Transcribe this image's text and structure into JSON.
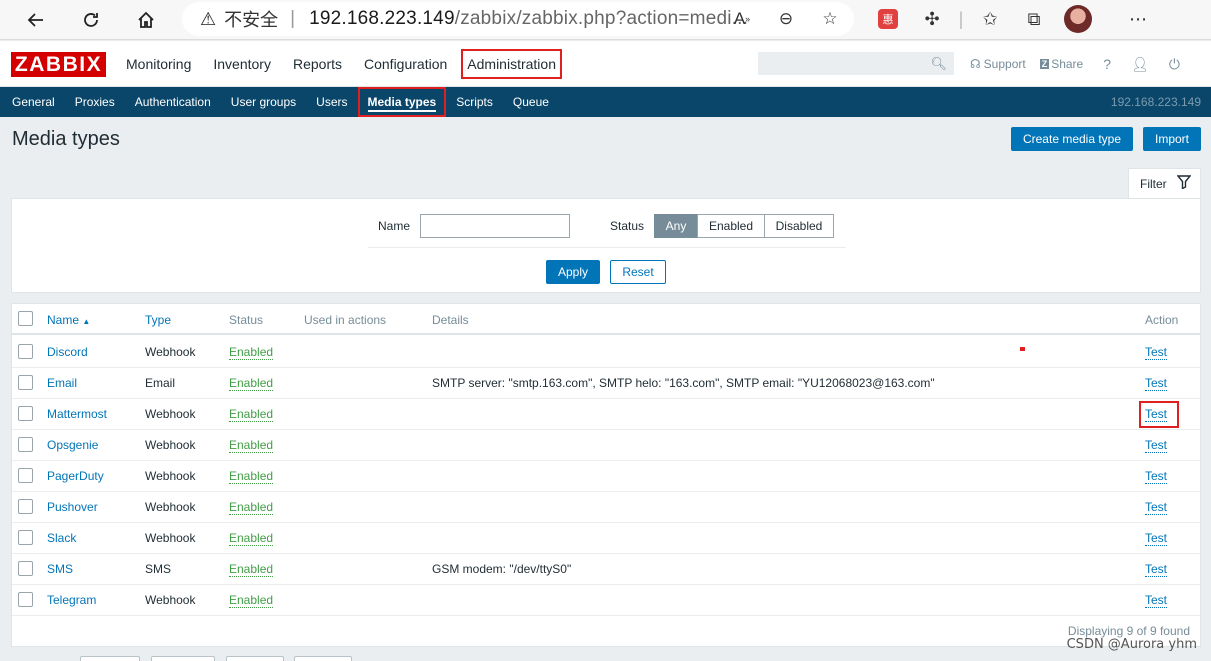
{
  "browser": {
    "insecure_label": "不安全",
    "url_host": "192.168.223.149",
    "url_rest": "/zabbix/zabbix.php?action=medi..."
  },
  "header": {
    "logo": "ZABBIX",
    "menu": [
      "Monitoring",
      "Inventory",
      "Reports",
      "Configuration",
      "Administration"
    ],
    "selected_menu": "Administration",
    "support": "Support",
    "share": "Share",
    "help": "?"
  },
  "subnav": {
    "items": [
      "General",
      "Proxies",
      "Authentication",
      "User groups",
      "Users",
      "Media types",
      "Scripts",
      "Queue"
    ],
    "selected": "Media types",
    "server": "192.168.223.149"
  },
  "page": {
    "title": "Media types",
    "create_button": "Create media type",
    "import_button": "Import"
  },
  "filter": {
    "tab_label": "Filter",
    "name_label": "Name",
    "name_value": "",
    "status_label": "Status",
    "status_options": [
      "Any",
      "Enabled",
      "Disabled"
    ],
    "status_selected": "Any",
    "apply": "Apply",
    "reset": "Reset"
  },
  "table": {
    "headers": {
      "name": "Name",
      "sort_indicator": "▲",
      "type": "Type",
      "status": "Status",
      "used": "Used in actions",
      "details": "Details",
      "action": "Action"
    },
    "rows": [
      {
        "name": "Discord",
        "type": "Webhook",
        "status": "Enabled",
        "details": "",
        "action": "Test"
      },
      {
        "name": "Email",
        "type": "Email",
        "status": "Enabled",
        "details": "SMTP server: \"smtp.163.com\", SMTP helo: \"163.com\", SMTP email: \"YU12068023@163.com\"",
        "action": "Test"
      },
      {
        "name": "Mattermost",
        "type": "Webhook",
        "status": "Enabled",
        "details": "",
        "action": "Test"
      },
      {
        "name": "Opsgenie",
        "type": "Webhook",
        "status": "Enabled",
        "details": "",
        "action": "Test"
      },
      {
        "name": "PagerDuty",
        "type": "Webhook",
        "status": "Enabled",
        "details": "",
        "action": "Test"
      },
      {
        "name": "Pushover",
        "type": "Webhook",
        "status": "Enabled",
        "details": "",
        "action": "Test"
      },
      {
        "name": "Slack",
        "type": "Webhook",
        "status": "Enabled",
        "details": "",
        "action": "Test"
      },
      {
        "name": "SMS",
        "type": "SMS",
        "status": "Enabled",
        "details": "GSM modem: \"/dev/ttyS0\"",
        "action": "Test"
      },
      {
        "name": "Telegram",
        "type": "Webhook",
        "status": "Enabled",
        "details": "",
        "action": "Test"
      }
    ],
    "footer": "Displaying 9 of 9 found"
  },
  "watermark": "CSDN @Aurora yhm"
}
